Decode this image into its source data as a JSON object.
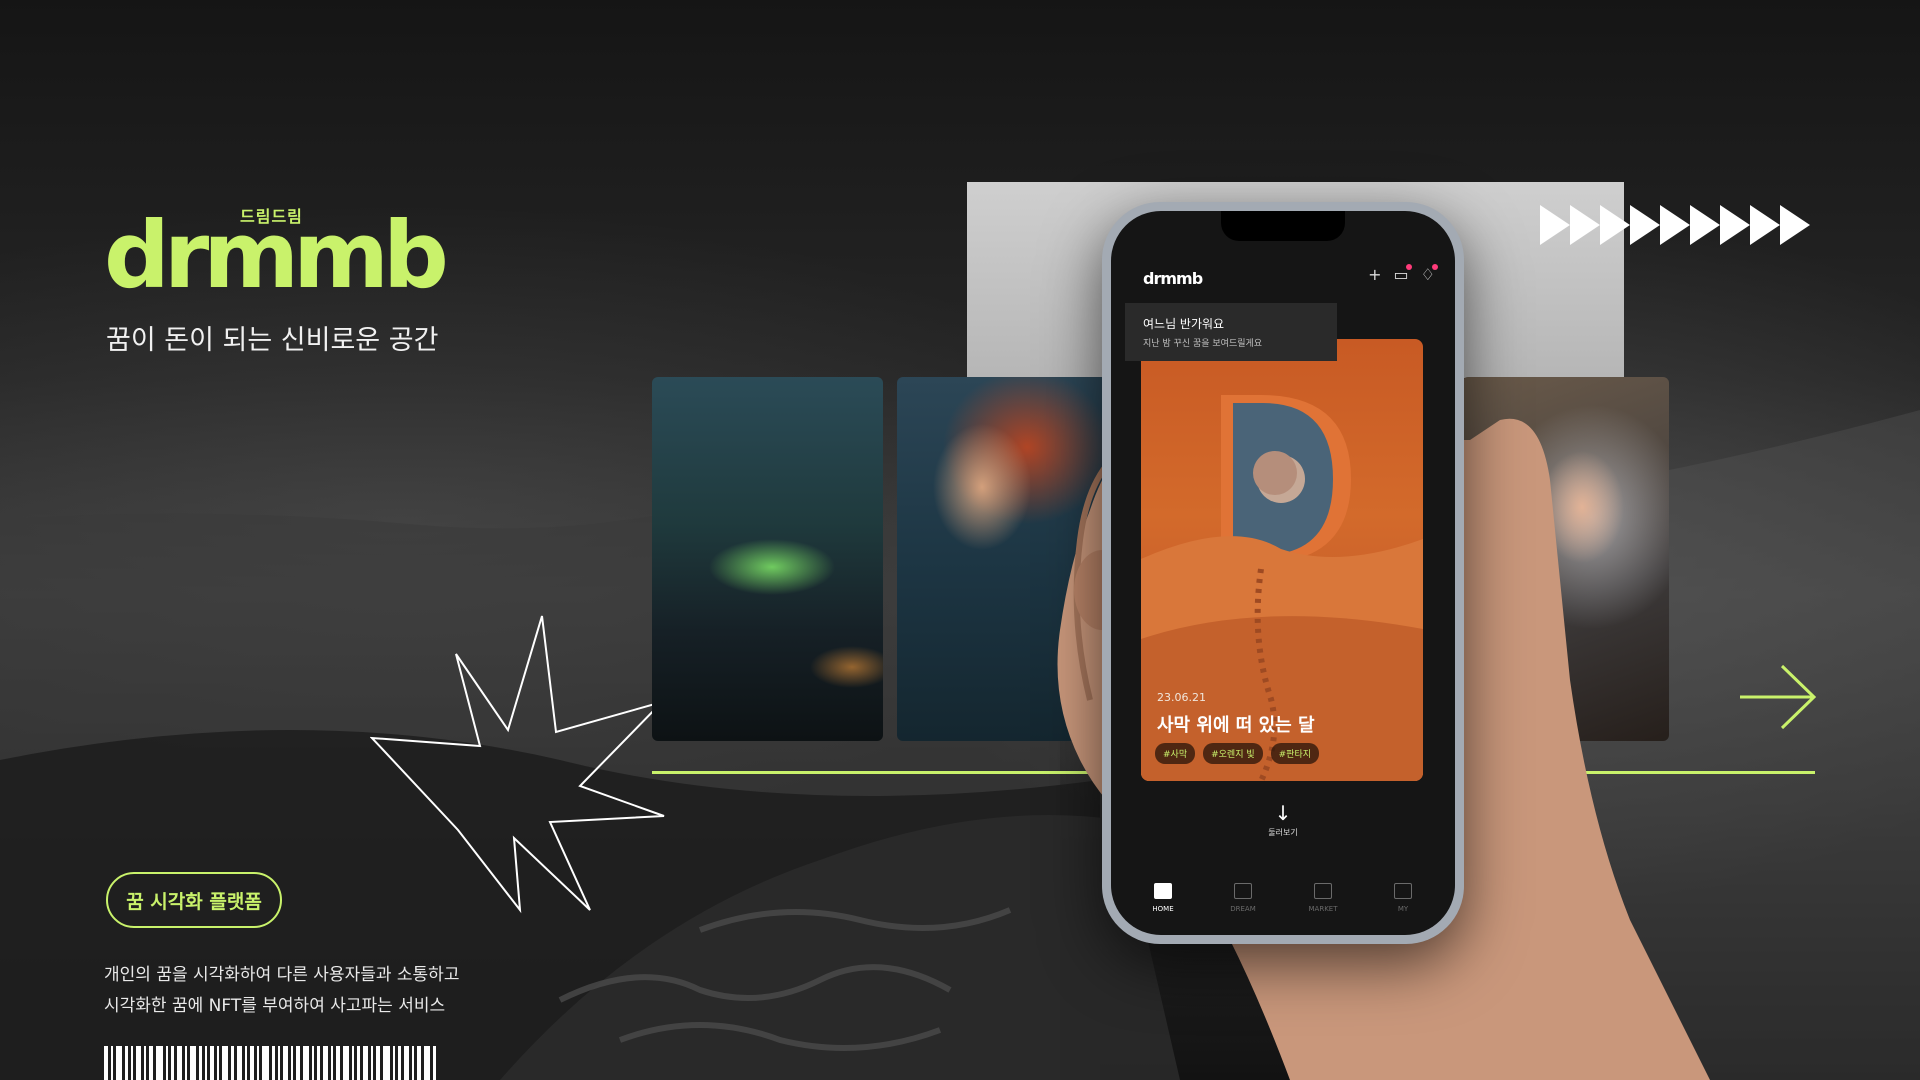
{
  "brand": {
    "sub_label": "드림드림",
    "logo_text": "drmmb",
    "tagline": "꿈이 돈이 되는 신비로운 공간",
    "pill_label": "꿈 시각화 플랫폼",
    "description_lines": [
      "개인의 꿈을 시각화하여 다른 사용자들과 소통하고",
      "시각화한 꿈에 NFT를 부여하여 사고파는 서비스"
    ]
  },
  "gallery": {
    "cards": [
      "card-car",
      "card-mermaid",
      "card-astronaut"
    ],
    "accent": "#c9f26b"
  },
  "app": {
    "logo": "drmmb",
    "top_icons": [
      "plus-icon",
      "calendar-icon",
      "bell-icon"
    ],
    "welcome": {
      "title": "여느님 반가워요",
      "subtitle": "지난 밤 꾸신 꿈을 보여드릴게요"
    },
    "dream": {
      "date": "23.06.21",
      "title": "사막 위에 떠 있는 달",
      "tags": [
        "#사막",
        "#오렌지 빛",
        "#판타지"
      ]
    },
    "more": {
      "icon": "arrow-down-icon",
      "label": "둘러보기"
    },
    "tabs": [
      {
        "label": "HOME",
        "icon": "home-icon",
        "active": true
      },
      {
        "label": "DREAM",
        "icon": "bed-icon",
        "active": false
      },
      {
        "label": "MARKET",
        "icon": "market-icon",
        "active": false
      },
      {
        "label": "MY",
        "icon": "user-icon",
        "active": false
      }
    ]
  },
  "colors": {
    "accent": "#c9f26b",
    "dream_orange": "#d36a2b",
    "notification": "#ff3b7a"
  }
}
